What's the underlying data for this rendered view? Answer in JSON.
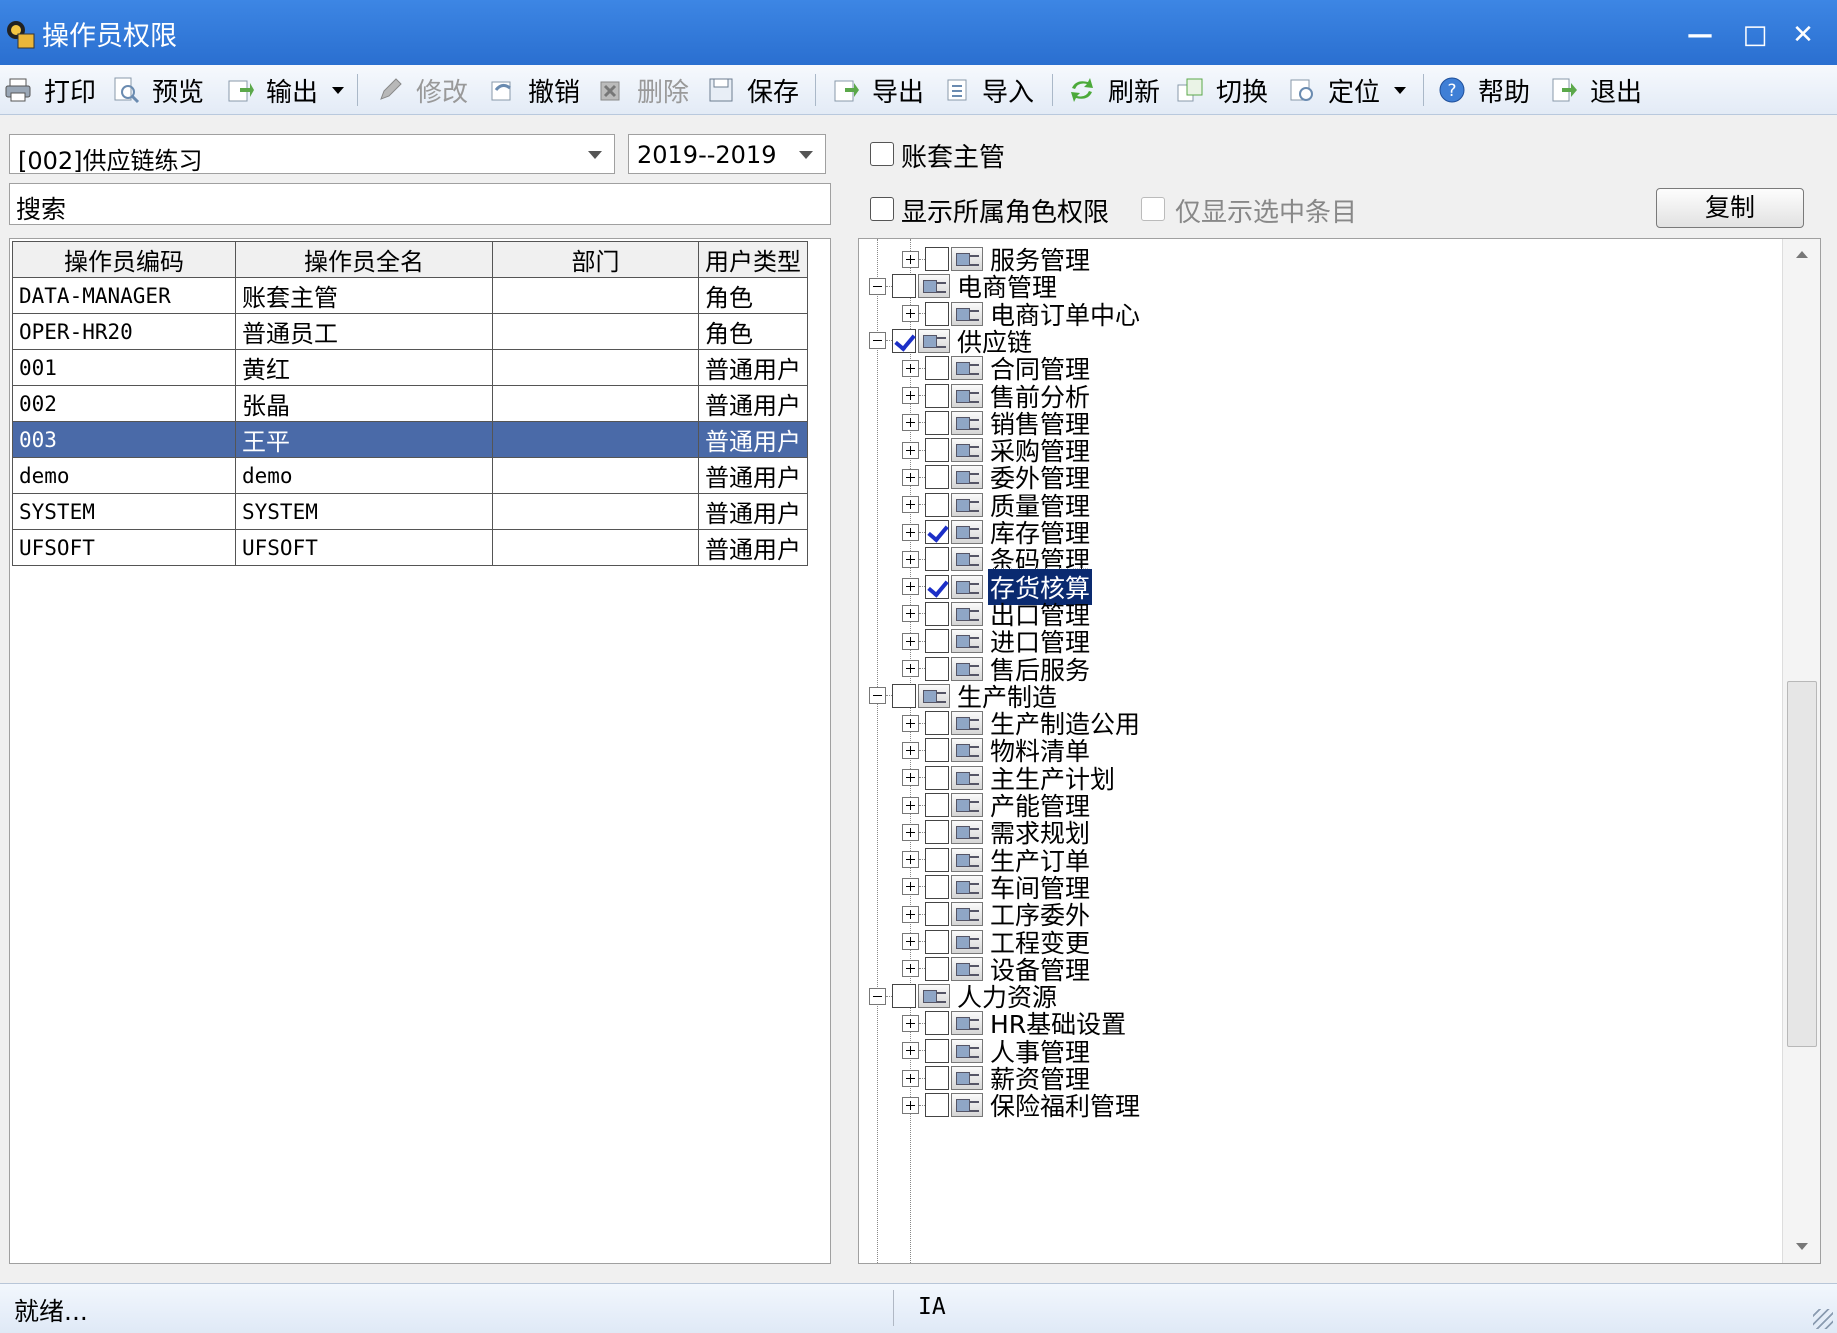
{
  "window": {
    "title": "操作员权限",
    "minimize": "—",
    "maximize": "□",
    "close": "✕"
  },
  "toolbar": [
    {
      "id": "print",
      "label": "打印",
      "icon": "printer-icon",
      "enabled": true
    },
    {
      "id": "preview",
      "label": "预览",
      "icon": "preview-icon",
      "enabled": true
    },
    {
      "id": "output",
      "label": "输出",
      "icon": "output-icon",
      "enabled": true,
      "dropdown": true
    },
    {
      "id": "edit",
      "label": "修改",
      "icon": "pencil-icon",
      "enabled": false
    },
    {
      "id": "undo",
      "label": "撤销",
      "icon": "undo-icon",
      "enabled": true
    },
    {
      "id": "delete",
      "label": "删除",
      "icon": "delete-icon",
      "enabled": false
    },
    {
      "id": "save",
      "label": "保存",
      "icon": "save-icon",
      "enabled": true
    },
    {
      "id": "export",
      "label": "导出",
      "icon": "export-icon",
      "enabled": true
    },
    {
      "id": "import",
      "label": "导入",
      "icon": "import-icon",
      "enabled": true
    },
    {
      "id": "refresh",
      "label": "刷新",
      "icon": "refresh-icon",
      "enabled": true
    },
    {
      "id": "switch",
      "label": "切换",
      "icon": "switch-icon",
      "enabled": true
    },
    {
      "id": "locate",
      "label": "定位",
      "icon": "locate-icon",
      "enabled": true,
      "dropdown": true
    },
    {
      "id": "help",
      "label": "帮助",
      "icon": "help-icon",
      "enabled": true
    },
    {
      "id": "exit",
      "label": "退出",
      "icon": "exit-icon",
      "enabled": true
    }
  ],
  "account_select": {
    "value": "[002]供应链练习"
  },
  "year_select": {
    "value": "2019--2019"
  },
  "search": {
    "placeholder": "搜索"
  },
  "options": {
    "account_supervisor": "账套主管",
    "show_role_perms": "显示所属角色权限",
    "only_selected": "仅显示选中条目",
    "copy_button": "复制"
  },
  "operators": {
    "columns": [
      "操作员编码",
      "操作员全名",
      "部门",
      "用户类型"
    ],
    "rows": [
      {
        "code": "DATA-MANAGER",
        "name": "账套主管",
        "dept": "",
        "type": "角色",
        "selected": false
      },
      {
        "code": "OPER-HR20",
        "name": "普通员工",
        "dept": "",
        "type": "角色",
        "selected": false
      },
      {
        "code": "001",
        "name": "黄红",
        "dept": "",
        "type": "普通用户",
        "selected": false
      },
      {
        "code": "002",
        "name": "张晶",
        "dept": "",
        "type": "普通用户",
        "selected": false
      },
      {
        "code": "003",
        "name": "王平",
        "dept": "",
        "type": "普通用户",
        "selected": true
      },
      {
        "code": "demo",
        "name": "demo",
        "dept": "",
        "type": "普通用户",
        "selected": false
      },
      {
        "code": "SYSTEM",
        "name": "SYSTEM",
        "dept": "",
        "type": "普通用户",
        "selected": false
      },
      {
        "code": "UFSOFT",
        "name": "UFSOFT",
        "dept": "",
        "type": "普通用户",
        "selected": false
      }
    ]
  },
  "tree": [
    {
      "label": "服务管理",
      "level": 1,
      "checked": false,
      "expander": "plus"
    },
    {
      "label": "电商管理",
      "level": 0,
      "checked": false,
      "expander": "minus"
    },
    {
      "label": "电商订单中心",
      "level": 1,
      "checked": false,
      "expander": "plus"
    },
    {
      "label": "供应链",
      "level": 0,
      "checked": true,
      "expander": "minus"
    },
    {
      "label": "合同管理",
      "level": 1,
      "checked": false,
      "expander": "plus"
    },
    {
      "label": "售前分析",
      "level": 1,
      "checked": false,
      "expander": "plus"
    },
    {
      "label": "销售管理",
      "level": 1,
      "checked": false,
      "expander": "plus"
    },
    {
      "label": "采购管理",
      "level": 1,
      "checked": false,
      "expander": "plus"
    },
    {
      "label": "委外管理",
      "level": 1,
      "checked": false,
      "expander": "plus"
    },
    {
      "label": "质量管理",
      "level": 1,
      "checked": false,
      "expander": "plus"
    },
    {
      "label": "库存管理",
      "level": 1,
      "checked": true,
      "expander": "plus"
    },
    {
      "label": "条码管理",
      "level": 1,
      "checked": false,
      "expander": "plus"
    },
    {
      "label": "存货核算",
      "level": 1,
      "checked": true,
      "expander": "plus",
      "highlight": true
    },
    {
      "label": "出口管理",
      "level": 1,
      "checked": false,
      "expander": "plus"
    },
    {
      "label": "进口管理",
      "level": 1,
      "checked": false,
      "expander": "plus"
    },
    {
      "label": "售后服务",
      "level": 1,
      "checked": false,
      "expander": "plus"
    },
    {
      "label": "生产制造",
      "level": 0,
      "checked": false,
      "expander": "minus"
    },
    {
      "label": "生产制造公用",
      "level": 1,
      "checked": false,
      "expander": "plus"
    },
    {
      "label": "物料清单",
      "level": 1,
      "checked": false,
      "expander": "plus"
    },
    {
      "label": "主生产计划",
      "level": 1,
      "checked": false,
      "expander": "plus"
    },
    {
      "label": "产能管理",
      "level": 1,
      "checked": false,
      "expander": "plus"
    },
    {
      "label": "需求规划",
      "level": 1,
      "checked": false,
      "expander": "plus"
    },
    {
      "label": "生产订单",
      "level": 1,
      "checked": false,
      "expander": "plus"
    },
    {
      "label": "车间管理",
      "level": 1,
      "checked": false,
      "expander": "plus"
    },
    {
      "label": "工序委外",
      "level": 1,
      "checked": false,
      "expander": "plus"
    },
    {
      "label": "工程变更",
      "level": 1,
      "checked": false,
      "expander": "plus"
    },
    {
      "label": "设备管理",
      "level": 1,
      "checked": false,
      "expander": "plus"
    },
    {
      "label": "人力资源",
      "level": 0,
      "checked": false,
      "expander": "minus"
    },
    {
      "label": "HR基础设置",
      "level": 1,
      "checked": false,
      "expander": "plus"
    },
    {
      "label": "人事管理",
      "level": 1,
      "checked": false,
      "expander": "plus"
    },
    {
      "label": "薪资管理",
      "level": 1,
      "checked": false,
      "expander": "plus"
    },
    {
      "label": "保险福利管理",
      "level": 1,
      "checked": false,
      "expander": "plus"
    }
  ],
  "status": {
    "left": "就绪...",
    "right": "IA"
  }
}
